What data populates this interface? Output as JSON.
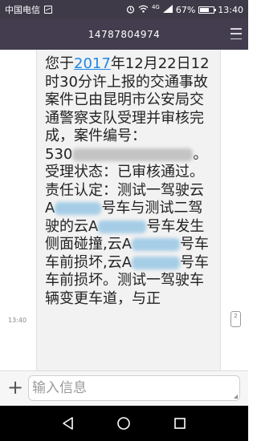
{
  "status_bar": {
    "carrier": "中国电信",
    "network": "4G",
    "battery_percent": "67%",
    "battery_level": 0.67,
    "time": "13:40",
    "icons": [
      "image-icon",
      "alarm-icon",
      "wifi-icon",
      "signal-icon",
      "battery-icon"
    ]
  },
  "header": {
    "contact": "14787804974",
    "menu_icon": "menu-icon"
  },
  "message": {
    "p1_text1": "您于",
    "p1_year_link": "2017",
    "p1_text2": "年12月22日12时30分许上报的交通事故案件已由昆明市公安局交通警察支队受理并审核完成，案件编号：",
    "case_no_prefix": "530",
    "case_no_suffix": "。",
    "p2": "受理状态：已审核通过。",
    "p3_a": "责任认定：测试一驾驶云A",
    "p3_b": "号车与测试二驾驶的云A",
    "p3_c": "号车发生侧面碰撞,云A",
    "p3_d": "号车车前损坏,云A",
    "p3_e": "号车车前损坏。测试一驾驶车辆变更车道，与正",
    "time": "13:40",
    "sim_badge": "2"
  },
  "composer": {
    "add_icon": "plus-icon",
    "placeholder": "输入信息"
  },
  "navigation": {
    "back_icon": "back-icon",
    "home_icon": "home-icon",
    "recents_icon": "recents-icon"
  }
}
